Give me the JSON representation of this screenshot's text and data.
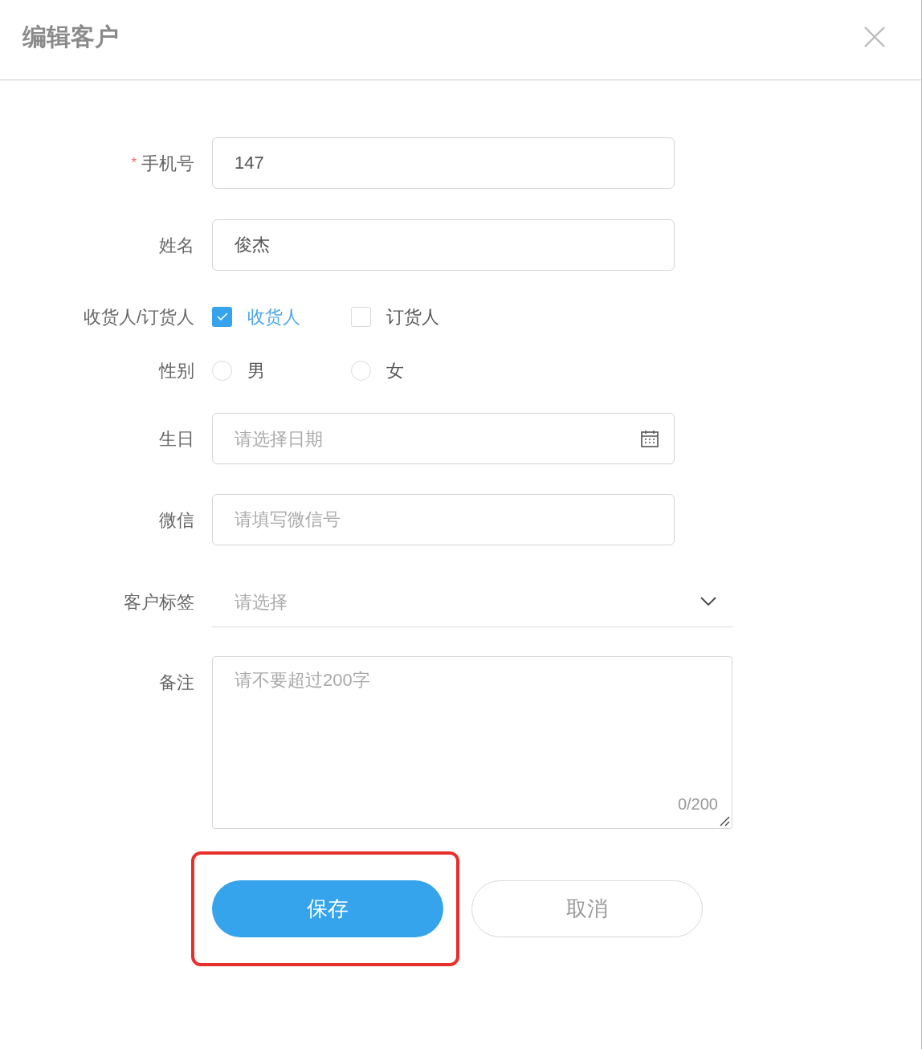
{
  "dialog": {
    "title": "编辑客户"
  },
  "fields": [
    {
      "kind": "text",
      "label": "手机号",
      "required_mark": "*",
      "value": "147"
    },
    {
      "kind": "text",
      "label": "姓名",
      "value": "俊杰"
    },
    {
      "kind": "checkbox",
      "label": "收货人/订货人",
      "options": [
        {
          "label": "收货人",
          "checked": true
        },
        {
          "label": "订货人",
          "checked": false
        }
      ]
    },
    {
      "kind": "radio",
      "label": "性别",
      "options": [
        {
          "label": "男",
          "selected": false
        },
        {
          "label": "女",
          "selected": false
        }
      ]
    },
    {
      "kind": "date",
      "label": "生日",
      "placeholder": "请选择日期"
    },
    {
      "kind": "text",
      "label": "微信",
      "placeholder": "请填写微信号"
    },
    {
      "kind": "select",
      "label": "客户标签",
      "placeholder": "请选择"
    },
    {
      "kind": "textarea",
      "label": "备注",
      "placeholder": "请不要超过200字",
      "counter": "0/200"
    }
  ],
  "buttons": [
    {
      "label": "保存",
      "kind": "primary"
    },
    {
      "label": "取消",
      "kind": "secondary"
    }
  ]
}
